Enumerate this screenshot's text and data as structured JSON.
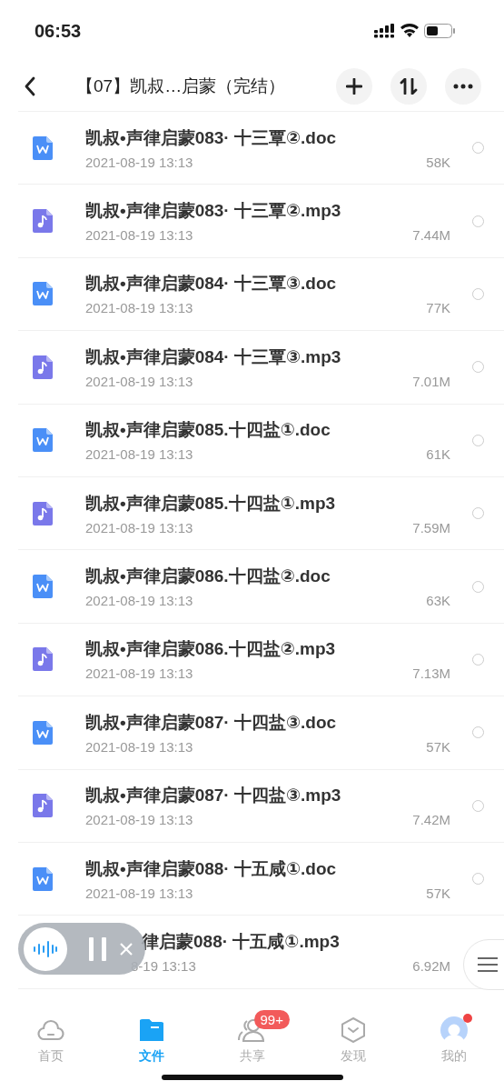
{
  "status_bar": {
    "time": "06:53"
  },
  "header": {
    "title": "【07】凯叔…启蒙（完结）"
  },
  "files": [
    {
      "kind": "doc",
      "name": "凯叔•声律启蒙083· 十三覃②.doc",
      "date": "2021-08-19 13:13",
      "size": "58K",
      "selected": false
    },
    {
      "kind": "audio",
      "name": "凯叔•声律启蒙083· 十三覃②.mp3",
      "date": "2021-08-19 13:13",
      "size": "7.44M",
      "selected": false
    },
    {
      "kind": "doc",
      "name": "凯叔•声律启蒙084· 十三覃③.doc",
      "date": "2021-08-19 13:13",
      "size": "77K",
      "selected": false
    },
    {
      "kind": "audio",
      "name": "凯叔•声律启蒙084· 十三覃③.mp3",
      "date": "2021-08-19 13:13",
      "size": "7.01M",
      "selected": false
    },
    {
      "kind": "doc",
      "name": "凯叔•声律启蒙085.十四盐①.doc",
      "date": "2021-08-19 13:13",
      "size": "61K",
      "selected": false
    },
    {
      "kind": "audio",
      "name": "凯叔•声律启蒙085.十四盐①.mp3",
      "date": "2021-08-19 13:13",
      "size": "7.59M",
      "selected": false
    },
    {
      "kind": "doc",
      "name": "凯叔•声律启蒙086.十四盐②.doc",
      "date": "2021-08-19 13:13",
      "size": "63K",
      "selected": false
    },
    {
      "kind": "audio",
      "name": "凯叔•声律启蒙086.十四盐②.mp3",
      "date": "2021-08-19 13:13",
      "size": "7.13M",
      "selected": false
    },
    {
      "kind": "doc",
      "name": "凯叔•声律启蒙087· 十四盐③.doc",
      "date": "2021-08-19 13:13",
      "size": "57K",
      "selected": false
    },
    {
      "kind": "audio",
      "name": "凯叔•声律启蒙087· 十四盐③.mp3",
      "date": "2021-08-19 13:13",
      "size": "7.42M",
      "selected": false
    },
    {
      "kind": "doc",
      "name": "凯叔•声律启蒙088· 十五咸①.doc",
      "date": "2021-08-19 13:13",
      "size": "57K",
      "selected": false
    },
    {
      "kind": "audio",
      "name": "律启蒙088· 十五咸①.mp3",
      "date": "8-19 13:13",
      "size": "6.92M"
    }
  ],
  "tabs": [
    {
      "label": "首页",
      "selected": false
    },
    {
      "label": "文件",
      "selected": true
    },
    {
      "label": "共享",
      "selected": false,
      "badge": "99+"
    },
    {
      "label": "发现",
      "selected": false
    },
    {
      "label": "我的",
      "selected": false,
      "dot": true
    }
  ]
}
